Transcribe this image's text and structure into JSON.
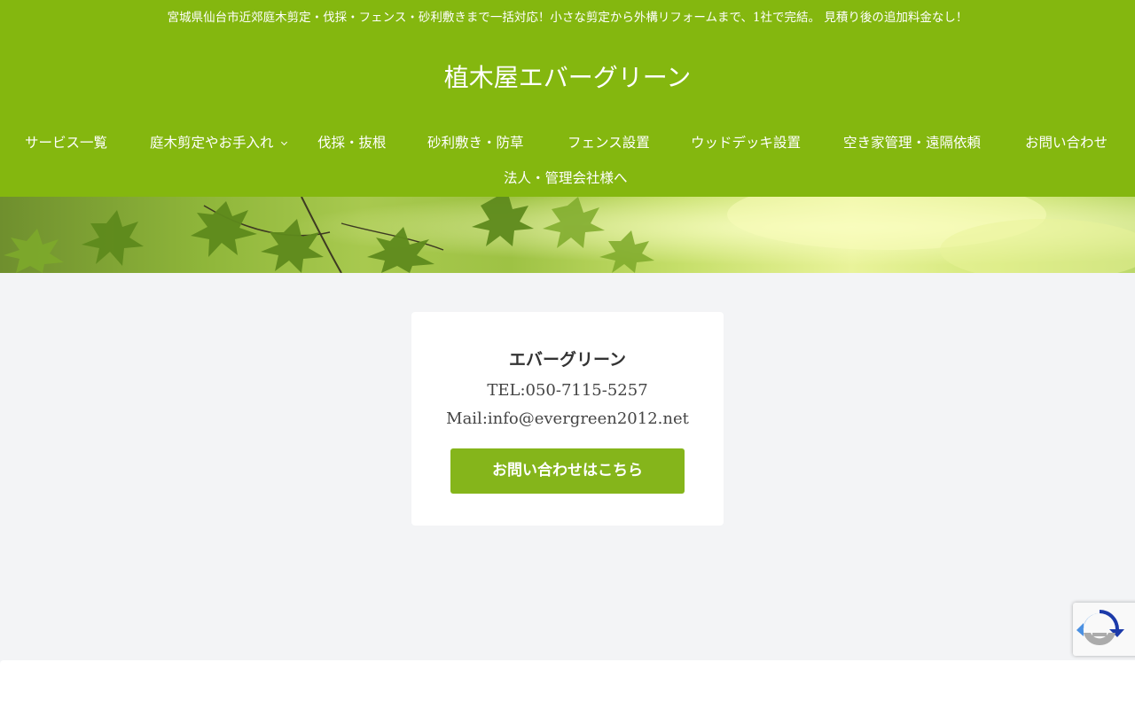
{
  "header": {
    "tagline": "宮城県仙台市近郊庭木剪定・伐採・フェンス・砂利敷きまで一括対応！小さな剪定から外構リフォームまで、1社で完結。 見積り後の追加料金なし！",
    "site_title": "植木屋エバーグリーン",
    "background_color": "#84b70f"
  },
  "nav": {
    "items": [
      {
        "label": "サービス一覧"
      },
      {
        "label": "庭木剪定やお手入れ",
        "has_dropdown": true
      },
      {
        "label": "伐採・抜根"
      },
      {
        "label": "砂利敷き・防草"
      },
      {
        "label": "フェンス設置"
      },
      {
        "label": "ウッドデッキ設置"
      },
      {
        "label": "空き家管理・遠隔依頼"
      },
      {
        "label": "お問い合わせ"
      },
      {
        "label": "法人・管理会社様へ"
      }
    ]
  },
  "contact_card": {
    "company": "エバーグリーン",
    "tel": "TEL:050-7115-5257",
    "mail": "Mail:info@evergreen2012.net",
    "button_label": "お問い合わせはこちら",
    "button_color": "#85b51b"
  },
  "icons": {
    "dropdown": "chevron-down-icon",
    "recaptcha": "recaptcha-icon"
  }
}
